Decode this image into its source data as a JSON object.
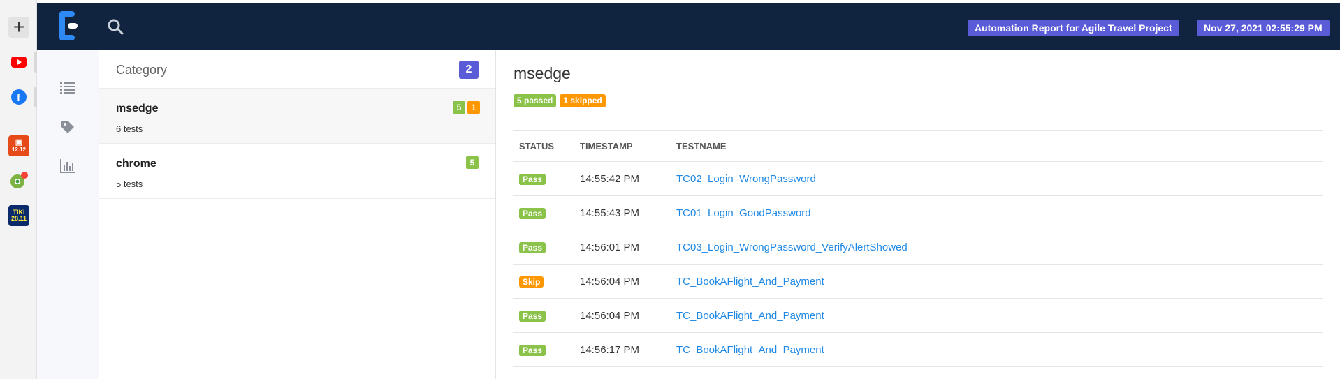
{
  "browser_rail": {
    "icons": [
      "add-icon",
      "youtube-icon",
      "facebook-icon",
      "shopee-icon",
      "chrome-extension-icon",
      "tiki-icon"
    ],
    "shopee_label": "12.12",
    "tiki_label_top": "TIKI",
    "tiki_label_bottom": "28.11",
    "add_symbol": "+"
  },
  "topbar": {
    "brand_icon": "extent-logo-icon",
    "search_icon": "search-icon",
    "report_title": "Automation Report for Agile Travel Project",
    "report_datetime": "Nov 27, 2021 02:55:29 PM"
  },
  "icon_nav": {
    "items": [
      "list-icon",
      "tag-icon",
      "bar-chart-icon"
    ]
  },
  "category_panel": {
    "title": "Category",
    "count": "2",
    "items": [
      {
        "name": "msedge",
        "sub": "6 tests",
        "passed": "5",
        "skipped": "1"
      },
      {
        "name": "chrome",
        "sub": "5 tests",
        "passed": "5"
      }
    ]
  },
  "detail": {
    "title": "msedge",
    "passed_badge": "5 passed",
    "skipped_badge": "1 skipped",
    "columns": [
      "STATUS",
      "TIMESTAMP",
      "TESTNAME"
    ],
    "rows": [
      {
        "status": "Pass",
        "time": "14:55:42 PM",
        "name": "TC02_Login_WrongPassword"
      },
      {
        "status": "Pass",
        "time": "14:55:43 PM",
        "name": "TC01_Login_GoodPassword"
      },
      {
        "status": "Pass",
        "time": "14:56:01 PM",
        "name": "TC03_Login_WrongPassword_VerifyAlertShowed"
      },
      {
        "status": "Skip",
        "time": "14:56:04 PM",
        "name": "TC_BookAFlight_And_Payment"
      },
      {
        "status": "Pass",
        "time": "14:56:04 PM",
        "name": "TC_BookAFlight_And_Payment"
      },
      {
        "status": "Pass",
        "time": "14:56:17 PM",
        "name": "TC_BookAFlight_And_Payment"
      }
    ]
  },
  "colors": {
    "navbar": "#11243f",
    "accent": "#5a5bd6",
    "pass": "#8bc34a",
    "skip": "#ff9800",
    "link": "#1e88e5"
  }
}
